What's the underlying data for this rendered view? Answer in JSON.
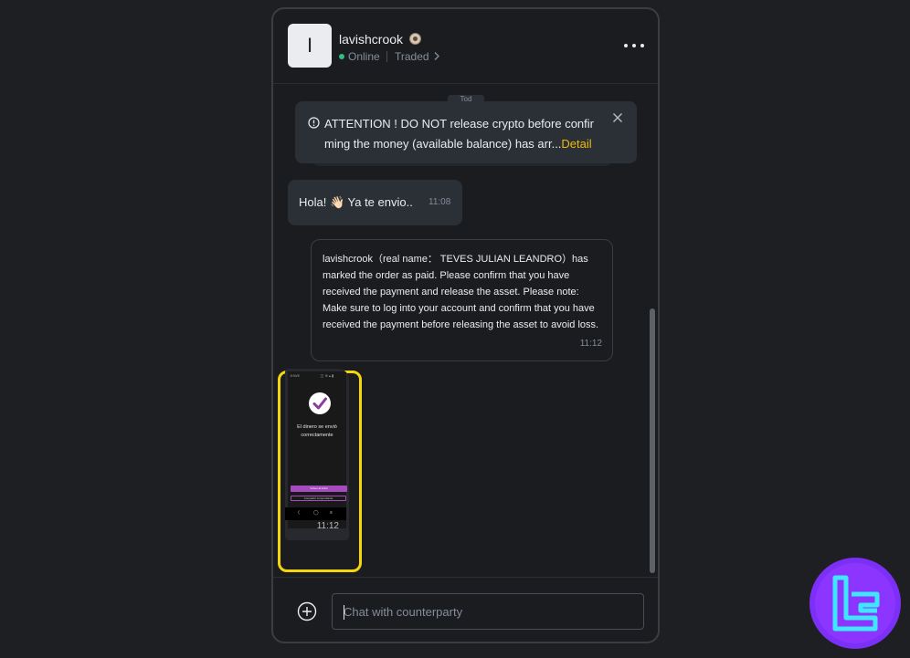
{
  "header": {
    "avatar_initial": "I",
    "username": "lavishcrook",
    "verified_icon": "verified-badge-icon",
    "status": "Online",
    "status_color": "#2ebd85",
    "traded_label": "Traded",
    "more_icon": "more-horizontal-icon"
  },
  "messages": {
    "peek_tag": "Tod",
    "notice": {
      "line1": "ATTENTION ! DO NOT release crypto before confir",
      "line2": "ming the money (available balance) has arr...",
      "detail_link": "Detail",
      "accent_color": "#f0b90b"
    },
    "hola": {
      "text": "Hola! 👋🏻 Ya te envio..",
      "time": "11:08"
    },
    "system": {
      "text": "lavishcrook（real name： TEVES JULIAN LEANDRO）has marked the order as paid. Please confirm that you have received the payment and release the asset. Please note: Make sure to log into your account and confirm that you have received the payment before releasing the asset to avoid loss.",
      "time": "11:12"
    },
    "image": {
      "statusbar": "JHWE                    ◫ ⊕ ▴ ▮",
      "phone_message": "El dinero se envió\ncorrectamente",
      "primary_btn": "Volver al inicio",
      "secondary_btn": "Compartir comprobante",
      "nav": [
        "⟨",
        "◯",
        "≡"
      ],
      "time": "11:12",
      "highlight_color": "#f5d60c"
    }
  },
  "composer": {
    "add_icon": "plus-circle-icon",
    "placeholder": "Chat with counterparty"
  }
}
